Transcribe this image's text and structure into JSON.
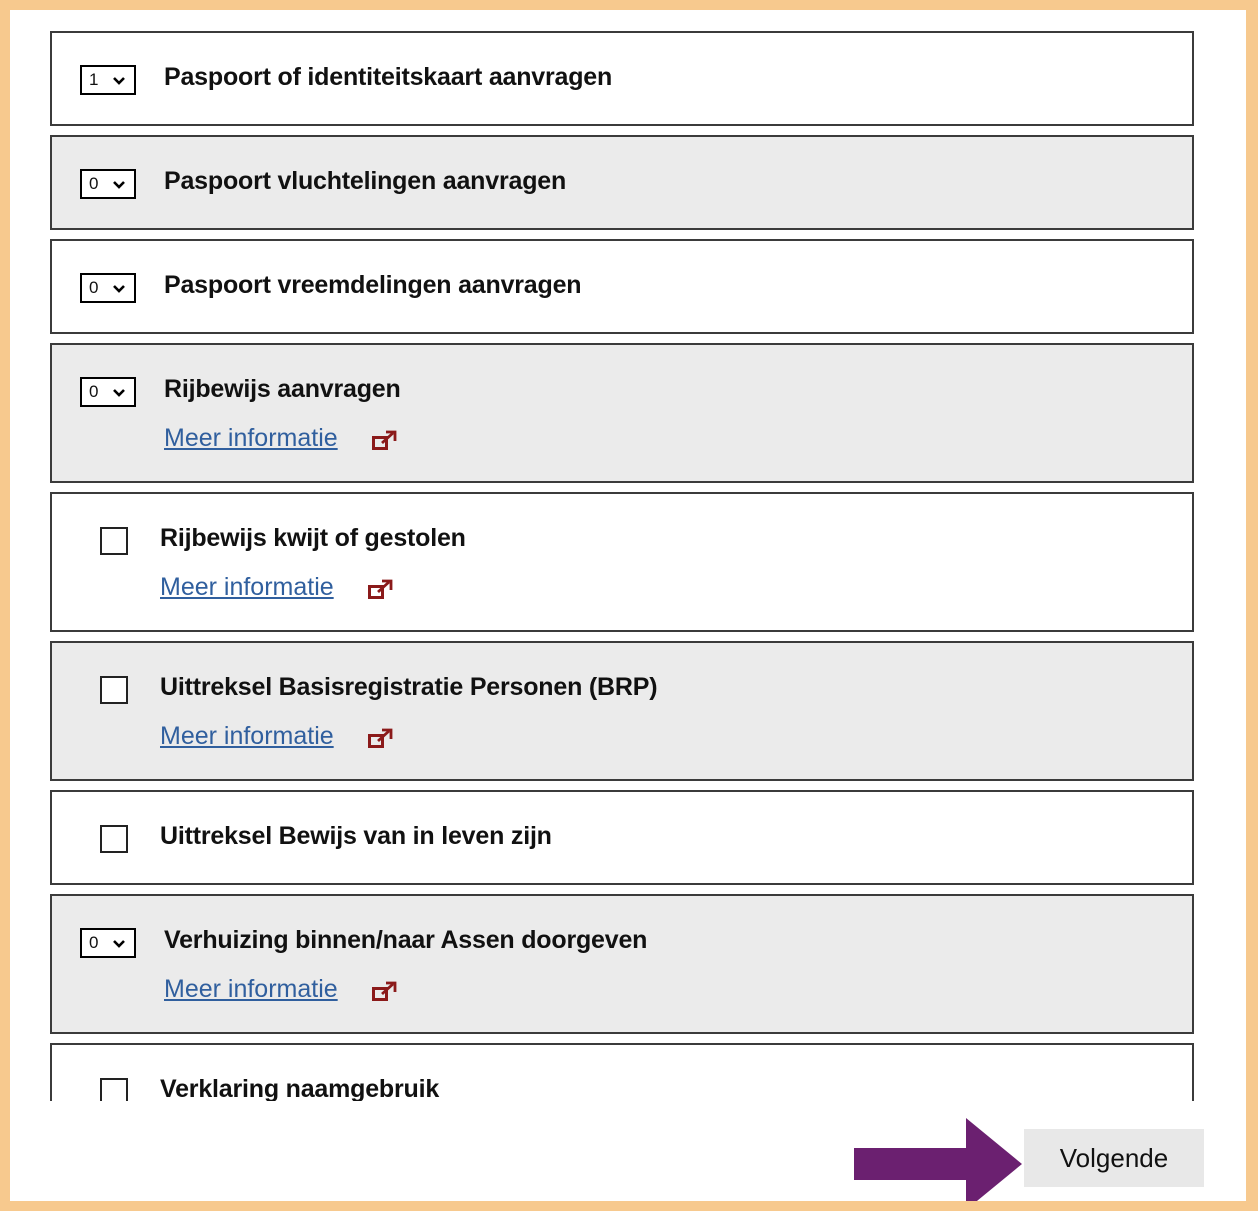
{
  "items": [
    {
      "type": "select",
      "value": "1",
      "title": "Paspoort of identiteitskaart aanvragen"
    },
    {
      "type": "select",
      "value": "0",
      "title": "Paspoort vluchtelingen aanvragen"
    },
    {
      "type": "select",
      "value": "0",
      "title": "Paspoort vreemdelingen aanvragen"
    },
    {
      "type": "select",
      "value": "0",
      "title": "Rijbewijs aanvragen",
      "more": "Meer informatie"
    },
    {
      "type": "checkbox",
      "checked": false,
      "title": "Rijbewijs kwijt of gestolen",
      "more": "Meer informatie"
    },
    {
      "type": "checkbox",
      "checked": false,
      "title": "Uittreksel Basisregistratie Personen (BRP)",
      "more": "Meer informatie"
    },
    {
      "type": "checkbox",
      "checked": false,
      "title": "Uittreksel Bewijs van in leven zijn"
    },
    {
      "type": "select",
      "value": "0",
      "title": "Verhuizing binnen/naar Assen doorgeven",
      "more": "Meer informatie"
    },
    {
      "type": "checkbox",
      "checked": false,
      "title": "Verklaring naamgebruik"
    }
  ],
  "next_button": {
    "label": "Volgende"
  },
  "colors": {
    "frame": "#f7c98e",
    "arrow": "#6b2070",
    "row_alt": "#ebebeb",
    "link": "#305f9e",
    "ext_icon": "#8b1a1a"
  },
  "icons": {
    "select": "chevron-down-icon",
    "more": "external-link-icon",
    "annotation": "arrow-right-icon"
  }
}
